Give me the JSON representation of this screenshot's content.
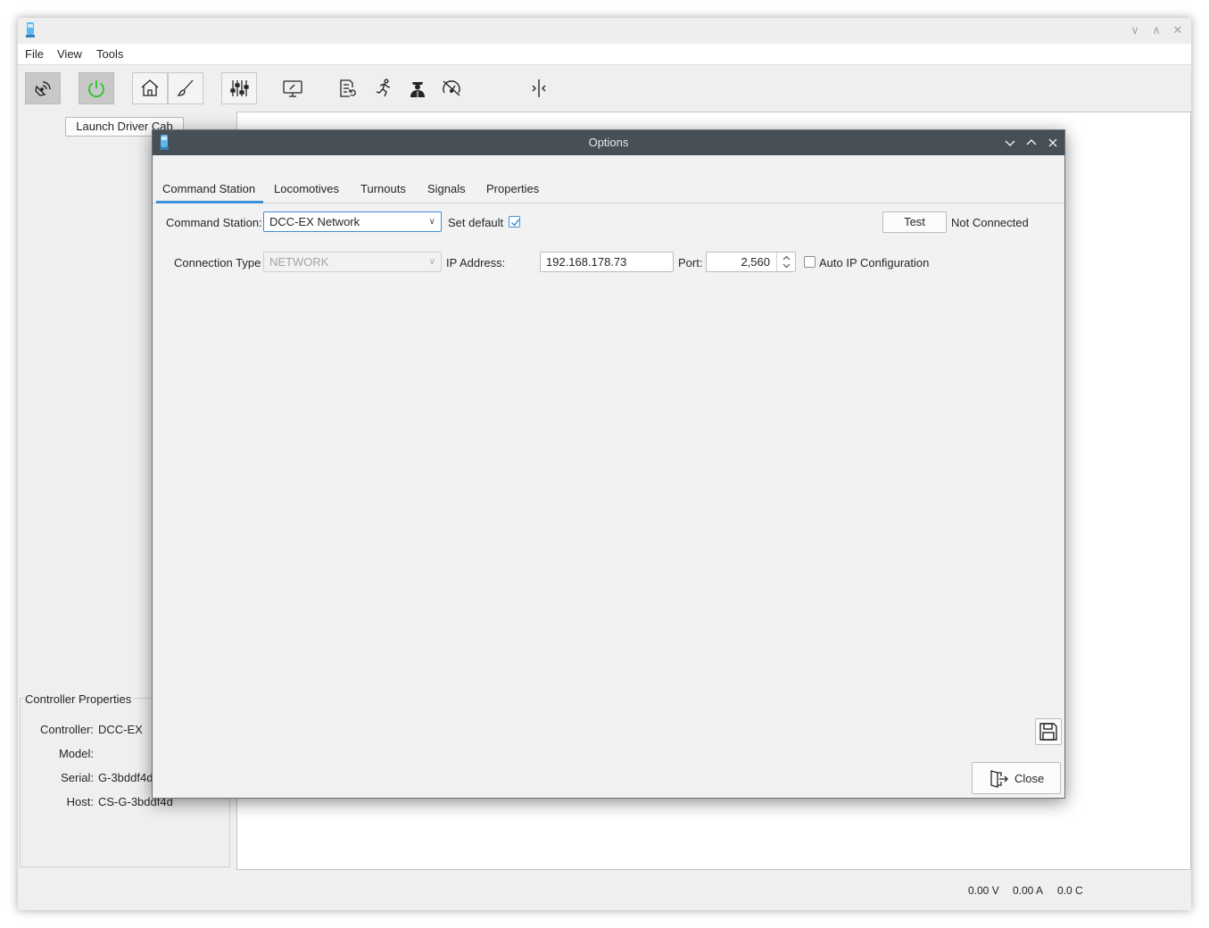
{
  "main": {
    "menu": [
      "File",
      "View",
      "Tools"
    ],
    "toolbar_icons": [
      "signal-icon",
      "power-icon",
      "home-icon",
      "brush-icon",
      "sliders-icon",
      "monitor-icon",
      "document-refresh-icon",
      "running-person-icon",
      "conductor-icon",
      "speedometer-icon",
      "split-icon"
    ],
    "launch_button": "Launch Driver Cab",
    "controller_properties": {
      "title": "Controller Properties",
      "rows": [
        {
          "label": "Controller:",
          "value": "DCC-EX"
        },
        {
          "label": "Model:",
          "value": ""
        },
        {
          "label": "Serial:",
          "value": "G-3bddf4d"
        },
        {
          "label": "Host:",
          "value": "CS-G-3bddf4d"
        }
      ]
    },
    "status": {
      "voltage": "0.00 V",
      "current": "0.00 A",
      "temperature": "0.0 C"
    }
  },
  "dialog": {
    "title": "Options",
    "tabs": [
      "Command Station",
      "Locomotives",
      "Turnouts",
      "Signals",
      "Properties"
    ],
    "active_tab": "Command Station",
    "command_station_label": "Command Station:",
    "command_station_value": "DCC-EX Network",
    "set_default_label": "Set default",
    "set_default_checked": true,
    "test_button": "Test",
    "connection_status": "Not Connected",
    "connection_type_label": "Connection Type",
    "connection_type_value": "NETWORK",
    "ip_label": "IP Address:",
    "ip_value": "192.168.178.73",
    "port_label": "Port:",
    "port_value": "2,560",
    "auto_ip_label": "Auto IP Configuration",
    "auto_ip_checked": false,
    "close_button": "Close"
  },
  "colors": {
    "accent": "#3d8fd9",
    "dialog_titlebar": "#475057",
    "power_green": "#3cc43c"
  }
}
